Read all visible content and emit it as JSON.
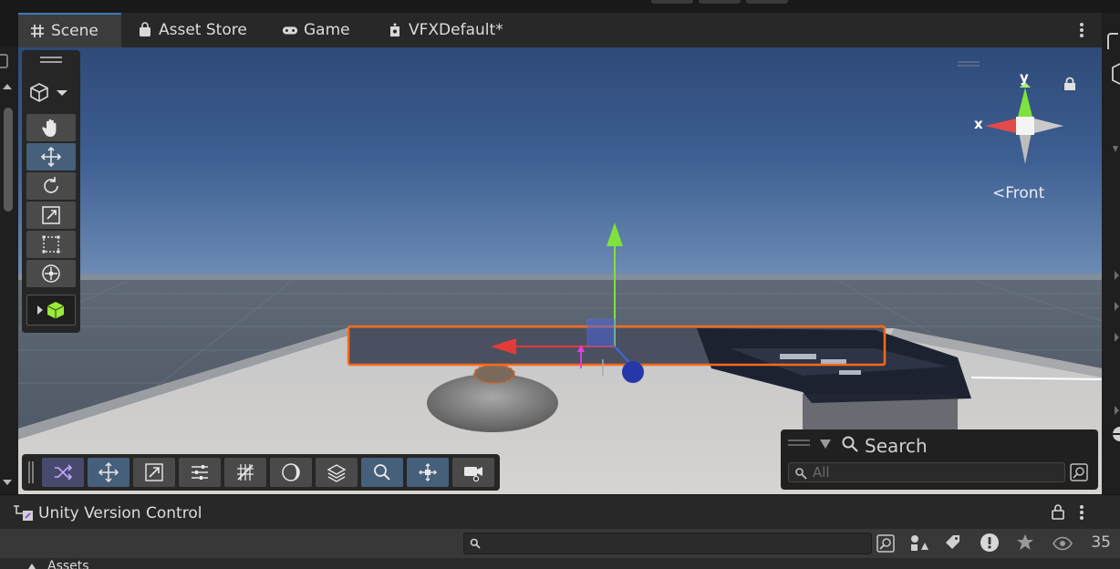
{
  "tabs": [
    {
      "label": "Scene",
      "icon": "grid-icon"
    },
    {
      "label": "Asset Store",
      "icon": "bag-icon"
    },
    {
      "label": "Game",
      "icon": "gamepad-icon"
    },
    {
      "label": "VFXDefault*",
      "icon": "vfx-icon"
    }
  ],
  "toolbar": {
    "tools": [
      "hand-tool",
      "move-tool",
      "rotate-tool",
      "scale-tool",
      "rect-tool",
      "transform-tool"
    ],
    "active_tool": "move-tool"
  },
  "gizmo": {
    "y_label": "y",
    "x_label": "x",
    "view_label": "Front"
  },
  "overlay_toolbar": {
    "buttons": [
      "shuffle-button",
      "move-button",
      "scale-move-button",
      "sliders-button",
      "grid-snap-button",
      "shading-button",
      "layers-button",
      "zoom-button",
      "pivot-button",
      "camera-button"
    ],
    "active": [
      "move-button",
      "zoom-button",
      "pivot-button"
    ]
  },
  "search_overlay": {
    "title": "Search",
    "placeholder": "All"
  },
  "version_control": {
    "title": "Unity Version Control"
  },
  "project": {
    "visible_count": "35",
    "folder_label": "Assets"
  },
  "colors": {
    "accent": "#3a79bb",
    "active_button": "#46607c",
    "selection_outline": "#ff6a1a",
    "x_axis": "#e33a3a",
    "y_axis": "#7ee13e",
    "z_axis": "#3b68f0"
  }
}
